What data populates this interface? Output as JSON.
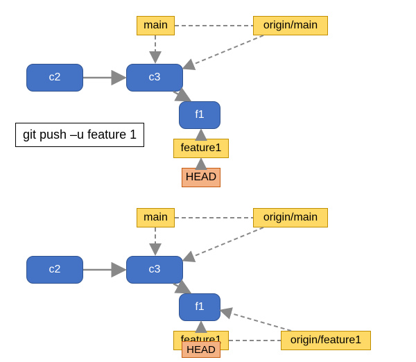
{
  "command": "git push –u feature 1",
  "top": {
    "commits": {
      "c2": "c2",
      "c3": "c3",
      "f1": "f1"
    },
    "branches": {
      "main": "main",
      "feature1": "feature1"
    },
    "remotes": {
      "origin_main": "origin/main"
    },
    "head": "HEAD"
  },
  "bottom": {
    "commits": {
      "c2": "c2",
      "c3": "c3",
      "f1": "f1"
    },
    "branches": {
      "main": "main",
      "feature1": "feature1"
    },
    "remotes": {
      "origin_main": "origin/main",
      "origin_feature1": "origin/feature1"
    },
    "head": "HEAD"
  }
}
